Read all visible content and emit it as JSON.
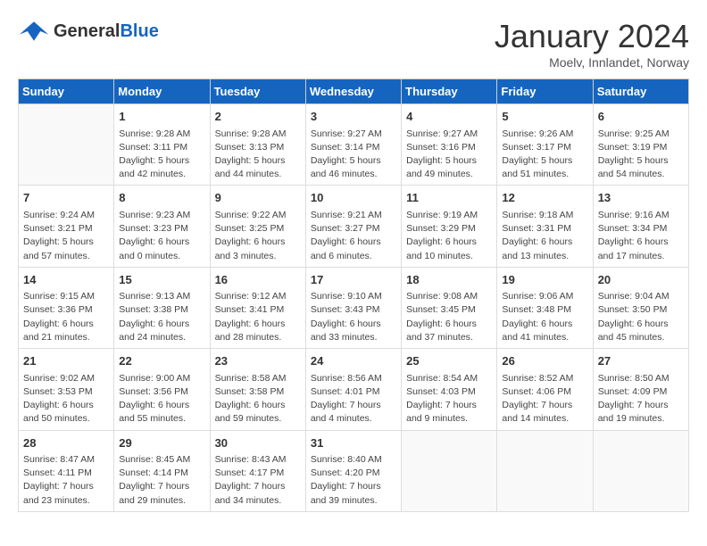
{
  "header": {
    "logo_general": "General",
    "logo_blue": "Blue",
    "title": "January 2024",
    "subtitle": "Moelv, Innlandet, Norway"
  },
  "calendar": {
    "days_of_week": [
      "Sunday",
      "Monday",
      "Tuesday",
      "Wednesday",
      "Thursday",
      "Friday",
      "Saturday"
    ],
    "weeks": [
      [
        {
          "day": "",
          "info": ""
        },
        {
          "day": "1",
          "info": "Sunrise: 9:28 AM\nSunset: 3:11 PM\nDaylight: 5 hours\nand 42 minutes."
        },
        {
          "day": "2",
          "info": "Sunrise: 9:28 AM\nSunset: 3:13 PM\nDaylight: 5 hours\nand 44 minutes."
        },
        {
          "day": "3",
          "info": "Sunrise: 9:27 AM\nSunset: 3:14 PM\nDaylight: 5 hours\nand 46 minutes."
        },
        {
          "day": "4",
          "info": "Sunrise: 9:27 AM\nSunset: 3:16 PM\nDaylight: 5 hours\nand 49 minutes."
        },
        {
          "day": "5",
          "info": "Sunrise: 9:26 AM\nSunset: 3:17 PM\nDaylight: 5 hours\nand 51 minutes."
        },
        {
          "day": "6",
          "info": "Sunrise: 9:25 AM\nSunset: 3:19 PM\nDaylight: 5 hours\nand 54 minutes."
        }
      ],
      [
        {
          "day": "7",
          "info": "Sunrise: 9:24 AM\nSunset: 3:21 PM\nDaylight: 5 hours\nand 57 minutes."
        },
        {
          "day": "8",
          "info": "Sunrise: 9:23 AM\nSunset: 3:23 PM\nDaylight: 6 hours\nand 0 minutes."
        },
        {
          "day": "9",
          "info": "Sunrise: 9:22 AM\nSunset: 3:25 PM\nDaylight: 6 hours\nand 3 minutes."
        },
        {
          "day": "10",
          "info": "Sunrise: 9:21 AM\nSunset: 3:27 PM\nDaylight: 6 hours\nand 6 minutes."
        },
        {
          "day": "11",
          "info": "Sunrise: 9:19 AM\nSunset: 3:29 PM\nDaylight: 6 hours\nand 10 minutes."
        },
        {
          "day": "12",
          "info": "Sunrise: 9:18 AM\nSunset: 3:31 PM\nDaylight: 6 hours\nand 13 minutes."
        },
        {
          "day": "13",
          "info": "Sunrise: 9:16 AM\nSunset: 3:34 PM\nDaylight: 6 hours\nand 17 minutes."
        }
      ],
      [
        {
          "day": "14",
          "info": "Sunrise: 9:15 AM\nSunset: 3:36 PM\nDaylight: 6 hours\nand 21 minutes."
        },
        {
          "day": "15",
          "info": "Sunrise: 9:13 AM\nSunset: 3:38 PM\nDaylight: 6 hours\nand 24 minutes."
        },
        {
          "day": "16",
          "info": "Sunrise: 9:12 AM\nSunset: 3:41 PM\nDaylight: 6 hours\nand 28 minutes."
        },
        {
          "day": "17",
          "info": "Sunrise: 9:10 AM\nSunset: 3:43 PM\nDaylight: 6 hours\nand 33 minutes."
        },
        {
          "day": "18",
          "info": "Sunrise: 9:08 AM\nSunset: 3:45 PM\nDaylight: 6 hours\nand 37 minutes."
        },
        {
          "day": "19",
          "info": "Sunrise: 9:06 AM\nSunset: 3:48 PM\nDaylight: 6 hours\nand 41 minutes."
        },
        {
          "day": "20",
          "info": "Sunrise: 9:04 AM\nSunset: 3:50 PM\nDaylight: 6 hours\nand 45 minutes."
        }
      ],
      [
        {
          "day": "21",
          "info": "Sunrise: 9:02 AM\nSunset: 3:53 PM\nDaylight: 6 hours\nand 50 minutes."
        },
        {
          "day": "22",
          "info": "Sunrise: 9:00 AM\nSunset: 3:56 PM\nDaylight: 6 hours\nand 55 minutes."
        },
        {
          "day": "23",
          "info": "Sunrise: 8:58 AM\nSunset: 3:58 PM\nDaylight: 6 hours\nand 59 minutes."
        },
        {
          "day": "24",
          "info": "Sunrise: 8:56 AM\nSunset: 4:01 PM\nDaylight: 7 hours\nand 4 minutes."
        },
        {
          "day": "25",
          "info": "Sunrise: 8:54 AM\nSunset: 4:03 PM\nDaylight: 7 hours\nand 9 minutes."
        },
        {
          "day": "26",
          "info": "Sunrise: 8:52 AM\nSunset: 4:06 PM\nDaylight: 7 hours\nand 14 minutes."
        },
        {
          "day": "27",
          "info": "Sunrise: 8:50 AM\nSunset: 4:09 PM\nDaylight: 7 hours\nand 19 minutes."
        }
      ],
      [
        {
          "day": "28",
          "info": "Sunrise: 8:47 AM\nSunset: 4:11 PM\nDaylight: 7 hours\nand 23 minutes."
        },
        {
          "day": "29",
          "info": "Sunrise: 8:45 AM\nSunset: 4:14 PM\nDaylight: 7 hours\nand 29 minutes."
        },
        {
          "day": "30",
          "info": "Sunrise: 8:43 AM\nSunset: 4:17 PM\nDaylight: 7 hours\nand 34 minutes."
        },
        {
          "day": "31",
          "info": "Sunrise: 8:40 AM\nSunset: 4:20 PM\nDaylight: 7 hours\nand 39 minutes."
        },
        {
          "day": "",
          "info": ""
        },
        {
          "day": "",
          "info": ""
        },
        {
          "day": "",
          "info": ""
        }
      ]
    ]
  }
}
